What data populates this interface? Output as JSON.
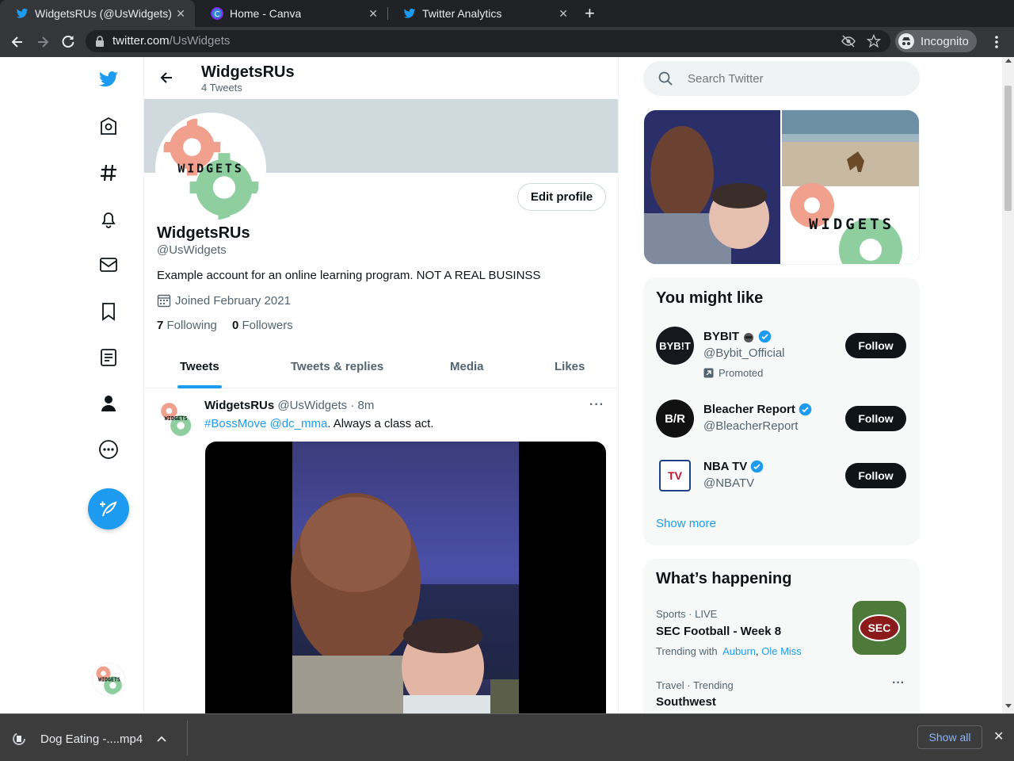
{
  "browser": {
    "tabs": [
      {
        "title": "WidgetsRUs (@UsWidgets) / Twitter",
        "icon": "twitter-bird-icon"
      },
      {
        "title": "Home - Canva",
        "icon": "canva-icon"
      },
      {
        "title": "Twitter Analytics",
        "icon": "twitter-bird-icon"
      }
    ],
    "url_domain": "twitter.com",
    "url_path": "/UsWidgets",
    "incognito_label": "Incognito"
  },
  "header": {
    "name": "WidgetsRUs",
    "tweet_count": "4 Tweets"
  },
  "profile": {
    "logo_text": "WIDGETS",
    "edit_label": "Edit profile",
    "name": "WidgetsRUs",
    "handle": "@UsWidgets",
    "bio": "Example account for an online learning program. NOT A REAL BUSINSS",
    "joined": "Joined February 2021",
    "following_count": "7",
    "following_label": "Following",
    "followers_count": "0",
    "followers_label": "Followers"
  },
  "profile_tabs": [
    "Tweets",
    "Tweets & replies",
    "Media",
    "Likes"
  ],
  "tweet": {
    "author": "WidgetsRUs",
    "handle": "@UsWidgets",
    "time": "· 8m",
    "hashtag": "#BossMove",
    "mention": "@dc_mma",
    "text_rest": ". Always a class act.",
    "more": "···"
  },
  "search": {
    "placeholder": "Search Twitter"
  },
  "media_grid_logo": "WIDGETS",
  "you_might_like": {
    "title": "You might like",
    "items": [
      {
        "name": "BYBIT",
        "handle": "@Bybit_Official",
        "promoted": "Promoted",
        "follow": "Follow",
        "avatar_text": "BYB!T"
      },
      {
        "name": "Bleacher Report",
        "handle": "@BleacherReport",
        "follow": "Follow",
        "avatar_text": "B/R"
      },
      {
        "name": "NBA TV",
        "handle": "@NBATV",
        "follow": "Follow",
        "avatar_text": "TV"
      }
    ],
    "show_more": "Show more"
  },
  "whats_happening": {
    "title": "What’s happening",
    "trends": [
      {
        "context": "Sports · LIVE",
        "title": "SEC Football - Week 8",
        "trending_with": "Trending with",
        "links": [
          "Auburn",
          "Ole Miss"
        ],
        "image_text": "SEC"
      },
      {
        "context": "Travel · Trending",
        "title": "Southwest"
      }
    ]
  },
  "downloads": {
    "file": "Dog Eating -....mp4",
    "show_all": "Show all"
  },
  "colors": {
    "twitter_blue": "#1d9bf0",
    "text": "#0f1419",
    "muted": "#536471",
    "gear_salmon": "#f0a08c",
    "gear_green": "#8fcf9f"
  }
}
